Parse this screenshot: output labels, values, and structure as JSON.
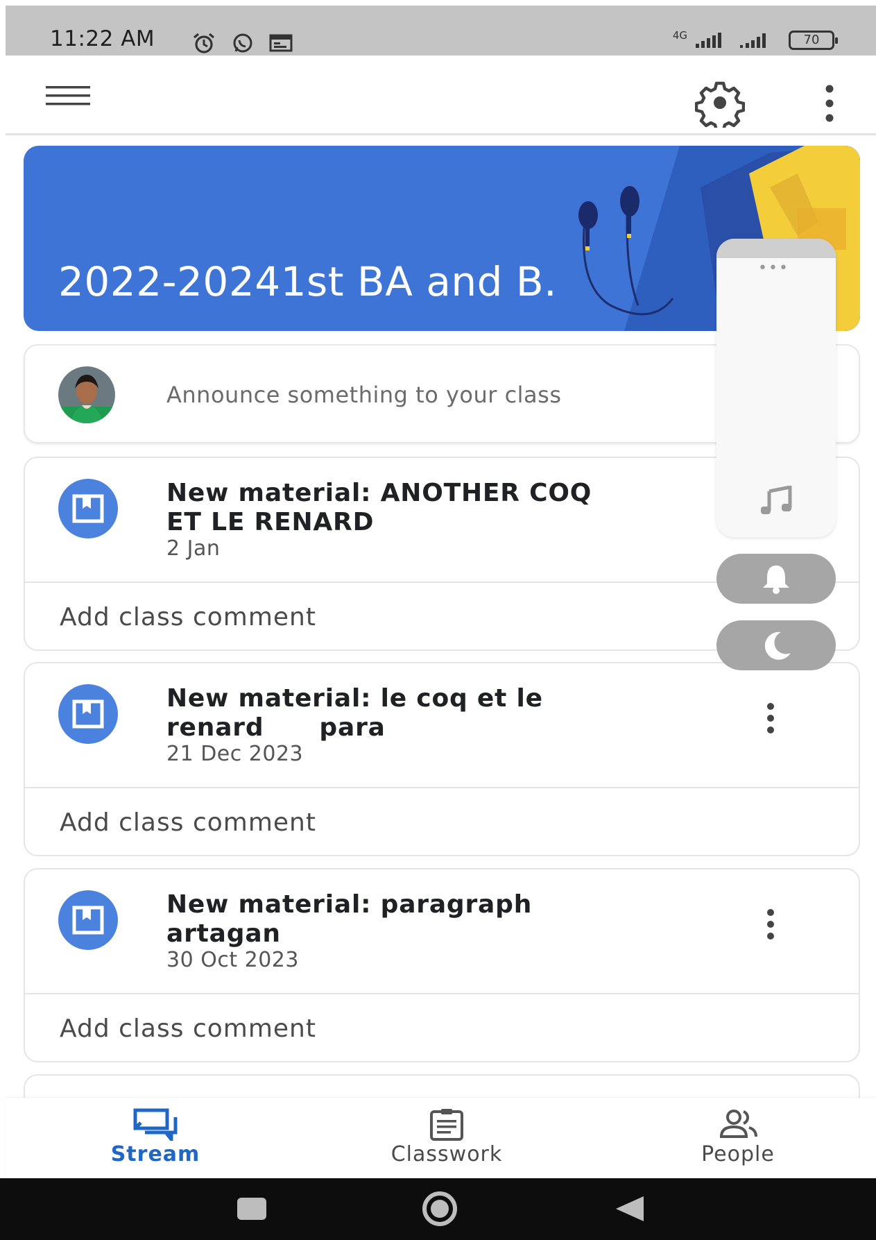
{
  "status_bar": {
    "time": "11:22 AM",
    "network_label": "4G",
    "battery": "70"
  },
  "banner": {
    "title": "2022-20241st BA and B.",
    "color": "#3d74d6"
  },
  "announce": {
    "placeholder": "Announce something to your class"
  },
  "posts": [
    {
      "title": "New material: ANOTHER COQ\nET LE RENARD",
      "date": "2 Jan",
      "comment": "Add class comment"
    },
    {
      "title": "New material: le coq et le\nrenard      para",
      "date": "21 Dec 2023",
      "comment": "Add class comment"
    },
    {
      "title": "New material: paragraph\nartagan",
      "date": "30 Oct 2023",
      "comment": "Add class comment"
    }
  ],
  "bottom_nav": [
    {
      "label": "Stream",
      "icon": "stream-icon",
      "active": true
    },
    {
      "label": "Classwork",
      "icon": "classwork-icon",
      "active": false
    },
    {
      "label": "People",
      "icon": "people-icon",
      "active": false
    }
  ],
  "colors": {
    "accent": "#1f67c5",
    "post_icon": "#4a82de",
    "floating_pill": "#a6a6a6"
  }
}
